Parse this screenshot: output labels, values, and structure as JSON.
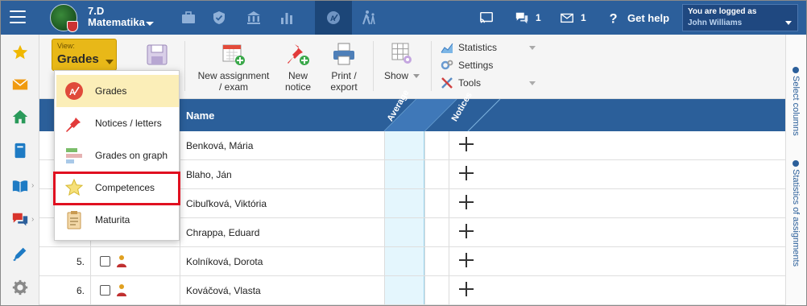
{
  "header": {
    "class_name": "7.D",
    "subject": "Matematika",
    "messages_count": "1",
    "mail_count": "1",
    "help_label": "Get help",
    "login_label": "You are logged as",
    "user_name": "John Williams"
  },
  "toolbar": {
    "view_label": "View:",
    "view_value": "Grades",
    "new_assignment_line1": "New assignment",
    "new_assignment_line2": "/ exam",
    "new_notice_line1": "New",
    "new_notice_line2": "notice",
    "print_line1": "Print /",
    "print_line2": "export",
    "show_label": "Show",
    "menu": [
      {
        "label": "Statistics",
        "icon": "chart-icon"
      },
      {
        "label": "Settings",
        "icon": "gears-icon"
      },
      {
        "label": "Tools",
        "icon": "tools-icon"
      }
    ]
  },
  "view_menu": [
    {
      "label": "Grades",
      "icon": "grades-icon",
      "active": true
    },
    {
      "label": "Notices / letters",
      "icon": "pin-icon"
    },
    {
      "label": "Grades on graph",
      "icon": "graph-icon"
    },
    {
      "label": "Competences",
      "icon": "star-icon"
    },
    {
      "label": "Maturita",
      "icon": "clipboard-icon"
    }
  ],
  "table": {
    "col_name": "Name",
    "col_average": "Average",
    "col_notices": "Notices",
    "rows": [
      {
        "num": "",
        "name": "Benková, Mária"
      },
      {
        "num": "",
        "name": "Blaho, Ján"
      },
      {
        "num": "",
        "name": "Cibuľková, Viktória"
      },
      {
        "num": "",
        "name": "Chrappa, Eduard"
      },
      {
        "num": "5.",
        "name": "Kolníková, Dorota"
      },
      {
        "num": "6.",
        "name": "Kováčová, Vlasta"
      }
    ]
  },
  "rightbar": {
    "select_columns": "Select columns",
    "stats_assignments": "Statistics of assignments"
  },
  "colors": {
    "header_blue": "#2c5f9b",
    "view_button": "#e8b818",
    "highlight_red": "#e01020",
    "average_column": "#e4f6fd"
  }
}
